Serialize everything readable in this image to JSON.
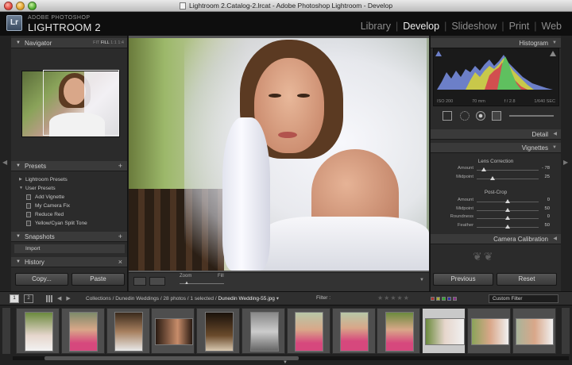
{
  "window": {
    "title": "Lightroom 2.Catalog-2.lrcat - Adobe Photoshop Lightroom - Develop"
  },
  "app": {
    "logo": "Lr",
    "brand_top": "ADOBE PHOTOSHOP",
    "brand_main": "LIGHTROOM 2"
  },
  "modules": [
    "Library",
    "Develop",
    "Slideshow",
    "Print",
    "Web"
  ],
  "active_module": "Develop",
  "navigator": {
    "title": "Navigator",
    "options": [
      "FIT",
      "FILL",
      "1:1",
      "1:4"
    ],
    "selected": "FILL"
  },
  "presets": {
    "title": "Presets",
    "groups": [
      {
        "label": "Lightroom Presets",
        "expanded": false
      },
      {
        "label": "User Presets",
        "expanded": true
      }
    ],
    "items": [
      "Add Vignette",
      "My Camera Fix",
      "Reduce Red",
      "Yellow/Cyan Split Tone"
    ]
  },
  "snapshots": {
    "title": "Snapshots",
    "items": [
      "Import"
    ]
  },
  "history": {
    "title": "History"
  },
  "left_buttons": {
    "copy": "Copy...",
    "paste": "Paste"
  },
  "toolbar": {
    "zoom_label": "Zoom",
    "fill_label": "Fill"
  },
  "histogram": {
    "title": "Histogram",
    "iso": "ISO 200",
    "focal": "70 mm",
    "aperture": "f / 2.8",
    "shutter": "1/640 SEC"
  },
  "detail": {
    "title": "Detail"
  },
  "vignettes": {
    "title": "Vignettes",
    "lens_correction": {
      "title": "Lens Correction",
      "sliders": [
        {
          "label": "Amount",
          "value": "- 78",
          "pos": 0.11
        },
        {
          "label": "Midpoint",
          "value": "25",
          "pos": 0.25
        }
      ]
    },
    "post_crop": {
      "title": "Post-Crop",
      "sliders": [
        {
          "label": "Amount",
          "value": "0",
          "pos": 0.5
        },
        {
          "label": "Midpoint",
          "value": "50",
          "pos": 0.5
        },
        {
          "label": "Roundness",
          "value": "0",
          "pos": 0.5
        },
        {
          "label": "Feather",
          "value": "50",
          "pos": 0.5
        }
      ]
    }
  },
  "camera_calibration": {
    "title": "Camera Calibration"
  },
  "right_buttons": {
    "previous": "Previous",
    "reset": "Reset"
  },
  "filmstrip": {
    "pages": [
      "1",
      "2"
    ],
    "breadcrumb_prefix": "Collections / Dunedin Weddings / 28 photos / 1 selected / ",
    "current_file": "Dunedin Wedding-55.jpg",
    "filter_label": "Filter :",
    "custom_filter": "Custom Filter",
    "thumbnails": 12,
    "selected_index": 9
  },
  "colors": {
    "accent_red": "#e0443a",
    "accent_yellow": "#e0a12a",
    "accent_green": "#4caa2c"
  }
}
